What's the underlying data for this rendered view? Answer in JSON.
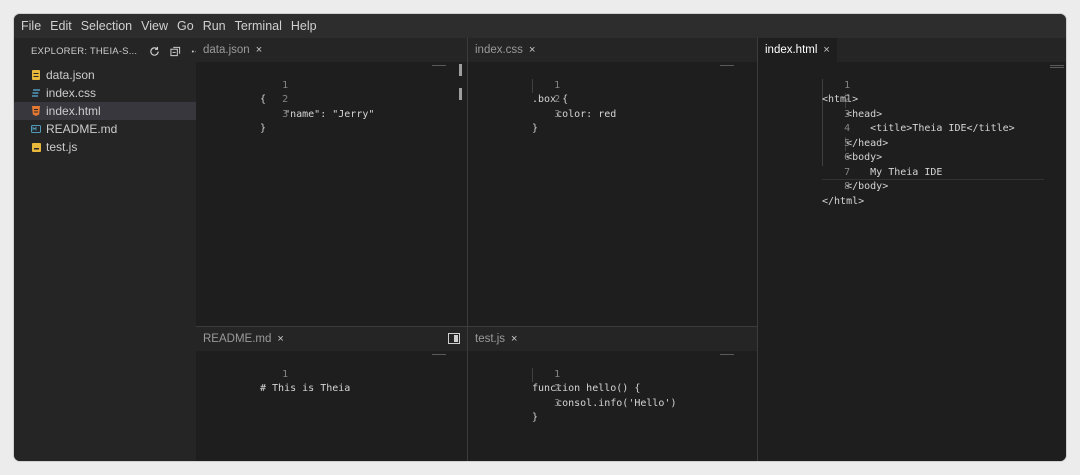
{
  "menu": [
    "File",
    "Edit",
    "Selection",
    "View",
    "Go",
    "Run",
    "Terminal",
    "Help"
  ],
  "explorer": {
    "title": "EXPLORER: THEIA-S...",
    "actions": [
      "refresh-icon",
      "collapse-all-icon",
      "more-icon"
    ],
    "files": [
      {
        "name": "data.json",
        "icon": "json-file-icon",
        "color": "#e8b83d"
      },
      {
        "name": "index.css",
        "icon": "css-file-icon",
        "color": "#519aba"
      },
      {
        "name": "index.html",
        "icon": "html-file-icon",
        "color": "#e37933",
        "selected": true
      },
      {
        "name": "README.md",
        "icon": "markdown-file-icon",
        "color": "#519aba"
      },
      {
        "name": "test.js",
        "icon": "js-file-icon",
        "color": "#e8b83d"
      }
    ]
  },
  "editors": {
    "data_json": {
      "tab": "data.json",
      "lines": [
        {
          "num": "1",
          "text": "{"
        },
        {
          "num": "2",
          "text": "    \"name\": \"Jerry\""
        },
        {
          "num": "3",
          "text": "}"
        }
      ]
    },
    "index_css": {
      "tab": "index.css",
      "lines": [
        {
          "num": "1",
          "text": ".box {"
        },
        {
          "num": "2",
          "text": "    color: red"
        },
        {
          "num": "3",
          "text": "}"
        }
      ]
    },
    "index_html": {
      "tab": "index.html",
      "lines": [
        {
          "num": "1",
          "text": "<html>"
        },
        {
          "num": "2",
          "text": "    <head>"
        },
        {
          "num": "3",
          "text": "        <title>Theia IDE</title>"
        },
        {
          "num": "4",
          "text": "    </head>"
        },
        {
          "num": "5",
          "text": "    <body>"
        },
        {
          "num": "6",
          "text": "        My Theia IDE"
        },
        {
          "num": "7",
          "text": "    </body>"
        },
        {
          "num": "8",
          "text": "</html>"
        }
      ]
    },
    "readme_md": {
      "tab": "README.md",
      "lines": [
        {
          "num": "1",
          "text": "# This is Theia"
        }
      ]
    },
    "test_js": {
      "tab": "test.js",
      "lines": [
        {
          "num": "1",
          "text": "function hello() {"
        },
        {
          "num": "2",
          "text": "    consol.info('Hello')"
        },
        {
          "num": "3",
          "text": "}"
        }
      ]
    }
  },
  "close_glyph": "×",
  "colors": {
    "editor_bg": "#1e1e1e",
    "sidebar_bg": "#252526",
    "menubar_bg": "#2d2d2e",
    "text": "#d4d4d4",
    "line_number": "#858585"
  }
}
